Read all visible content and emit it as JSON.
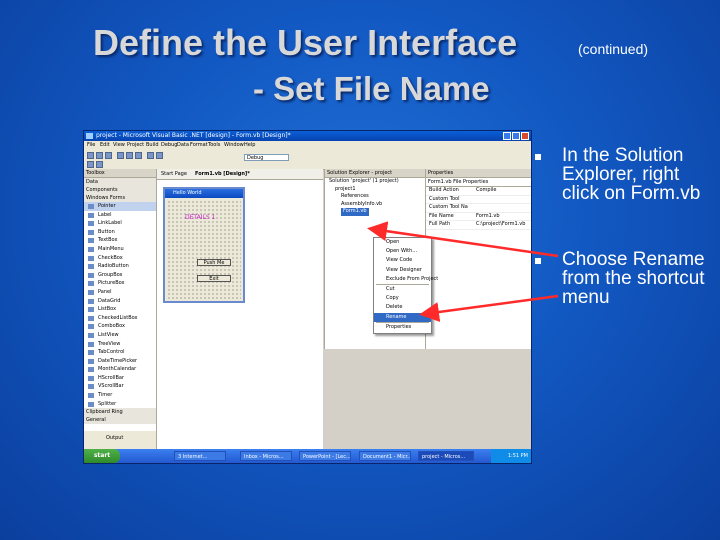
{
  "slide": {
    "title": "Define the User Interface",
    "title_suffix": "(continued)",
    "subtitle": "- Set File Name",
    "bullets": [
      {
        "text": "In the Solution Explorer, right click on Form.vb"
      },
      {
        "text": "Choose Rename from the shortcut menu"
      }
    ]
  },
  "screenshot": {
    "window_title": "project - Microsoft Visual Basic .NET [design] - Form.vb [Design]*",
    "menu": [
      "File",
      "Edit",
      "View",
      "Project",
      "Build",
      "Debug",
      "Data",
      "Format",
      "Tools",
      "Window",
      "Help"
    ],
    "toolbar_combo": "Debug",
    "toolbox": {
      "header": "Toolbox",
      "categories": [
        "Data",
        "Components",
        "Windows Forms"
      ],
      "items": [
        "Pointer",
        "Label",
        "LinkLabel",
        "Button",
        "TextBox",
        "MainMenu",
        "CheckBox",
        "RadioButton",
        "GroupBox",
        "PictureBox",
        "Panel",
        "DataGrid",
        "ListBox",
        "CheckedListBox",
        "ComboBox",
        "ListView",
        "TreeView",
        "TabControl",
        "DateTimePicker",
        "MonthCalendar",
        "HScrollBar",
        "VScrollBar",
        "Timer",
        "Splitter"
      ],
      "footer_categories": [
        "Clipboard Ring",
        "General"
      ],
      "output_tab": "Output"
    },
    "tabs": [
      "Start Page",
      "Form1.vb [Design]*"
    ],
    "form": {
      "title": "Hello World",
      "label": "DETAILS 1",
      "button1": "Push Me",
      "button2": "Exit"
    },
    "solution_explorer": {
      "header": "Solution Explorer - project",
      "nodes": [
        "Solution 'project' (1 project)",
        "project1",
        "References",
        "AssemblyInfo.vb",
        "Form1.vb"
      ]
    },
    "properties": {
      "header": "Properties",
      "object": "Form1.vb  File Properties",
      "rows": [
        {
          "name": "Build Action",
          "value": "Compile"
        },
        {
          "name": "Custom Tool",
          "value": ""
        },
        {
          "name": "Custom Tool Na",
          "value": ""
        },
        {
          "name": "File Name",
          "value": "Form1.vb"
        },
        {
          "name": "Full Path",
          "value": "C:\\project\\Form1.vb"
        }
      ]
    },
    "context_menu": [
      "Open",
      "Open With...",
      "View Code",
      "View Designer",
      "Exclude From Project",
      "Cut",
      "Copy",
      "Delete",
      "Rename",
      "Properties"
    ],
    "taskbar": {
      "start": "start",
      "tasks": [
        "3 Internet...",
        "Inbox - Micros...",
        "PowerPoint - [Lec...",
        "Document1 - Micr...",
        "project - Micros..."
      ],
      "clock": "1:51 PM"
    }
  }
}
